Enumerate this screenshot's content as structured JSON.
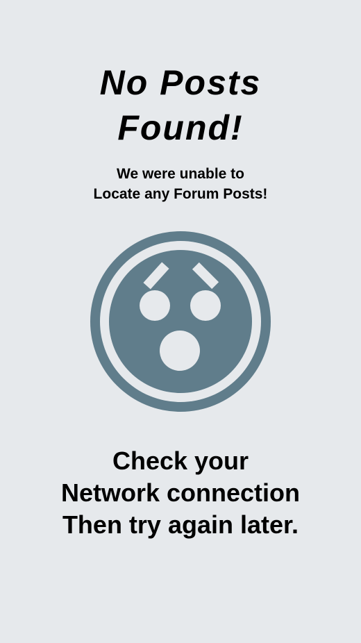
{
  "empty_state": {
    "title_line_1": "No Posts",
    "title_line_2": "Found!",
    "subtitle_line_1": "We were unable to",
    "subtitle_line_2": "Locate any Forum Posts!",
    "icon": "shocked-face-icon",
    "message_line_1": "Check your",
    "message_line_2": "Network connection",
    "message_line_3": "Then try again later."
  },
  "colors": {
    "background": "#e6e9ec",
    "icon": "#607d8b",
    "text": "#000000"
  }
}
